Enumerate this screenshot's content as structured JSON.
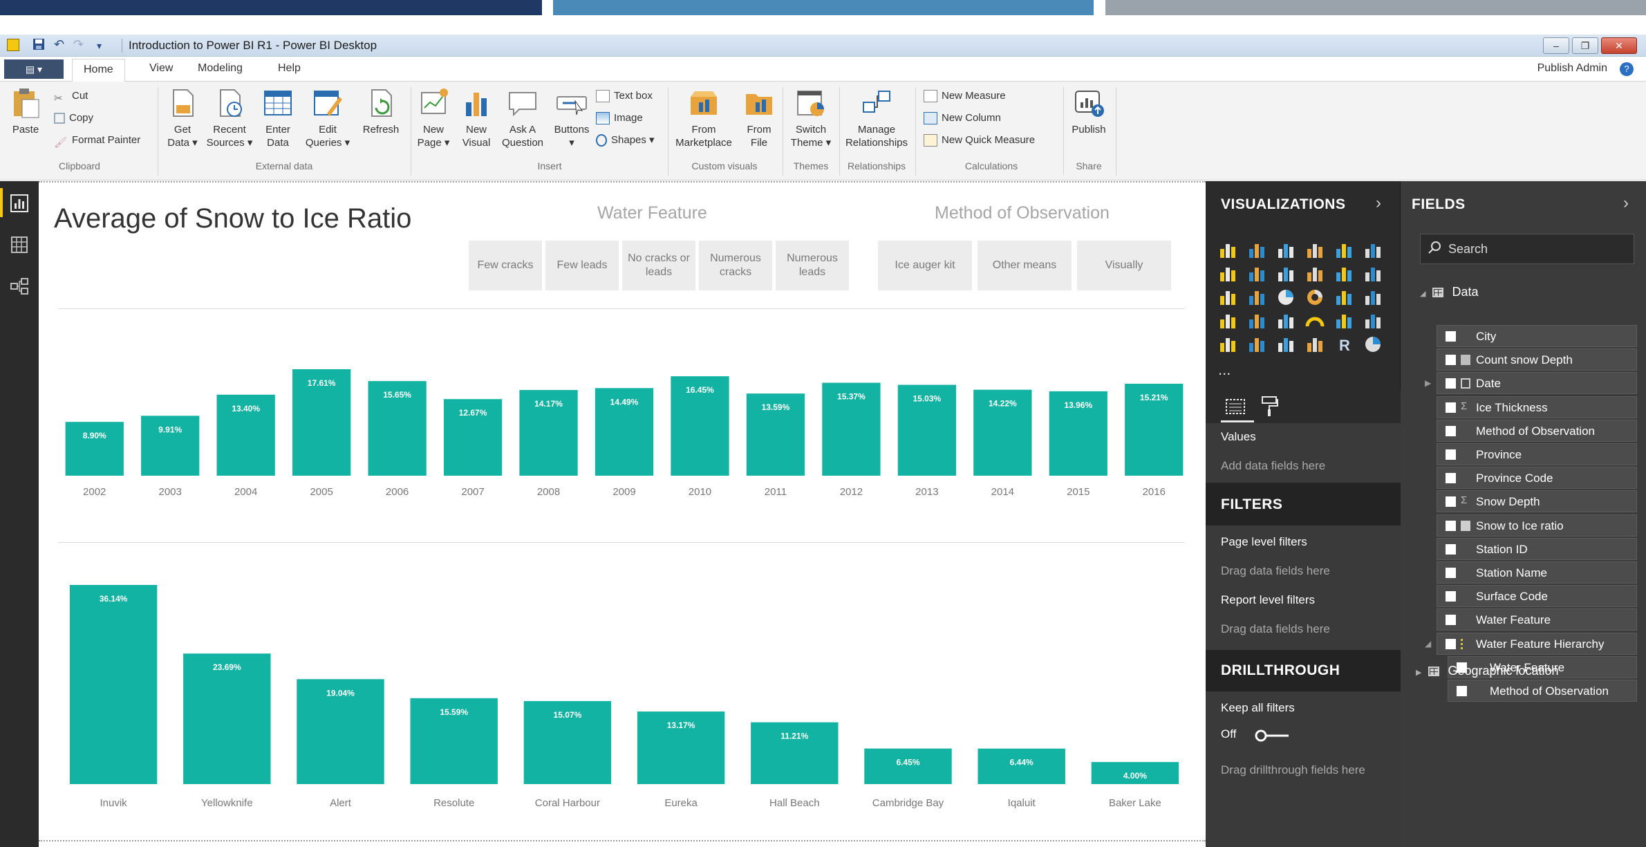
{
  "window": {
    "title": "Introduction to Power BI R1 - Power BI Desktop",
    "user": "Publish Admin"
  },
  "tabs": [
    "Home",
    "View",
    "Modeling",
    "Help"
  ],
  "ribbon": {
    "clipboard": {
      "paste": "Paste",
      "cut": "Cut",
      "copy": "Copy",
      "format_painter": "Format Painter",
      "label": "Clipboard"
    },
    "external": {
      "get_data": [
        "Get",
        "Data ▾"
      ],
      "recent": [
        "Recent",
        "Sources ▾"
      ],
      "enter": [
        "Enter",
        "Data"
      ],
      "edit": [
        "Edit",
        "Queries ▾"
      ],
      "refresh": "Refresh",
      "label": "External data"
    },
    "insert": {
      "new_page": [
        "New",
        "Page ▾"
      ],
      "new_visual": [
        "New",
        "Visual"
      ],
      "ask": [
        "Ask A",
        "Question"
      ],
      "buttons": [
        "Buttons",
        "▾"
      ],
      "text_box": "Text box",
      "image": "Image",
      "shapes": "Shapes ▾",
      "label": "Insert"
    },
    "custom": {
      "marketplace": [
        "From",
        "Marketplace"
      ],
      "file": [
        "From",
        "File"
      ],
      "label": "Custom visuals"
    },
    "themes": {
      "switch": [
        "Switch",
        "Theme ▾"
      ],
      "label": "Themes"
    },
    "relationships": {
      "manage": [
        "Manage",
        "Relationships"
      ],
      "label": "Relationships"
    },
    "calculations": {
      "new_measure": "New Measure",
      "new_column": "New Column",
      "new_quick": "New Quick Measure",
      "label": "Calculations"
    },
    "share": {
      "publish": "Publish",
      "label": "Share"
    }
  },
  "report": {
    "title": "Average of Snow to Ice Ratio",
    "slicer_water": {
      "title": "Water Feature",
      "options": [
        "Few cracks",
        "Few leads",
        "No cracks or leads",
        "Numerous cracks",
        "Numerous leads"
      ]
    },
    "slicer_method": {
      "title": "Method of Observation",
      "options": [
        "Ice auger kit",
        "Other means",
        "Visually"
      ]
    }
  },
  "chart_data": [
    {
      "type": "bar",
      "categories": [
        "2002",
        "2003",
        "2004",
        "2005",
        "2006",
        "2007",
        "2008",
        "2009",
        "2010",
        "2011",
        "2012",
        "2013",
        "2014",
        "2015",
        "2016"
      ],
      "values": [
        8.9,
        9.91,
        13.4,
        17.61,
        15.65,
        12.67,
        14.17,
        14.49,
        16.45,
        13.59,
        15.37,
        15.03,
        14.22,
        13.96,
        15.21
      ],
      "labels": [
        "8.90%",
        "9.91%",
        "13.40%",
        "17.61%",
        "15.65%",
        "12.67%",
        "14.17%",
        "14.49%",
        "16.45%",
        "13.59%",
        "15.37%",
        "15.03%",
        "14.22%",
        "13.96%",
        "15.21%"
      ],
      "color": "#13b3a3",
      "ylim": [
        0,
        17.61
      ]
    },
    {
      "type": "bar",
      "categories": [
        "Inuvik",
        "Yellowknife",
        "Alert",
        "Resolute",
        "Coral Harbour",
        "Eureka",
        "Hall Beach",
        "Cambridge Bay",
        "Iqaluit",
        "Baker Lake"
      ],
      "values": [
        36.14,
        23.69,
        19.04,
        15.59,
        15.07,
        13.17,
        11.21,
        6.45,
        6.44,
        4.0
      ],
      "labels": [
        "36.14%",
        "23.69%",
        "19.04%",
        "15.59%",
        "15.07%",
        "13.17%",
        "11.21%",
        "6.45%",
        "6.44%",
        "4.00%"
      ],
      "color": "#13b3a3",
      "ylim": [
        0,
        36.14
      ]
    }
  ],
  "visualizations": {
    "title": "VISUALIZATIONS",
    "ellipsis": "...",
    "values_label": "Values",
    "values_drop": "Add data fields here",
    "filters_title": "FILTERS",
    "page_filters": "Page level filters",
    "page_drop": "Drag data fields here",
    "report_filters": "Report level filters",
    "report_drop": "Drag data fields here",
    "drill_title": "DRILLTHROUGH",
    "keep_filters": "Keep all filters",
    "toggle_state": "Off",
    "drill_drop": "Drag drillthrough fields here"
  },
  "fields": {
    "title": "FIELDS",
    "search_placeholder": "Search",
    "table": "Data",
    "items": [
      {
        "label": "City",
        "icon": "none"
      },
      {
        "label": "Count snow Depth",
        "icon": "calc"
      },
      {
        "label": "Date",
        "icon": "table",
        "expandable": true
      },
      {
        "label": "Ice Thickness",
        "icon": "sigma"
      },
      {
        "label": "Method of Observation",
        "icon": "none"
      },
      {
        "label": "Province",
        "icon": "none"
      },
      {
        "label": "Province Code",
        "icon": "none"
      },
      {
        "label": "Snow Depth",
        "icon": "sigma"
      },
      {
        "label": "Snow to Ice ratio",
        "icon": "measure"
      },
      {
        "label": "Station ID",
        "icon": "none"
      },
      {
        "label": "Station Name",
        "icon": "none"
      },
      {
        "label": "Surface Code",
        "icon": "none"
      },
      {
        "label": "Water Feature",
        "icon": "none"
      },
      {
        "label": "Water Feature Hierarchy",
        "icon": "hierarchy",
        "expanded": true
      },
      {
        "label": "Water Feature",
        "icon": "none",
        "child": true
      },
      {
        "label": "Method of Observation",
        "icon": "none",
        "child": true
      }
    ],
    "geo": "Geographic location"
  }
}
